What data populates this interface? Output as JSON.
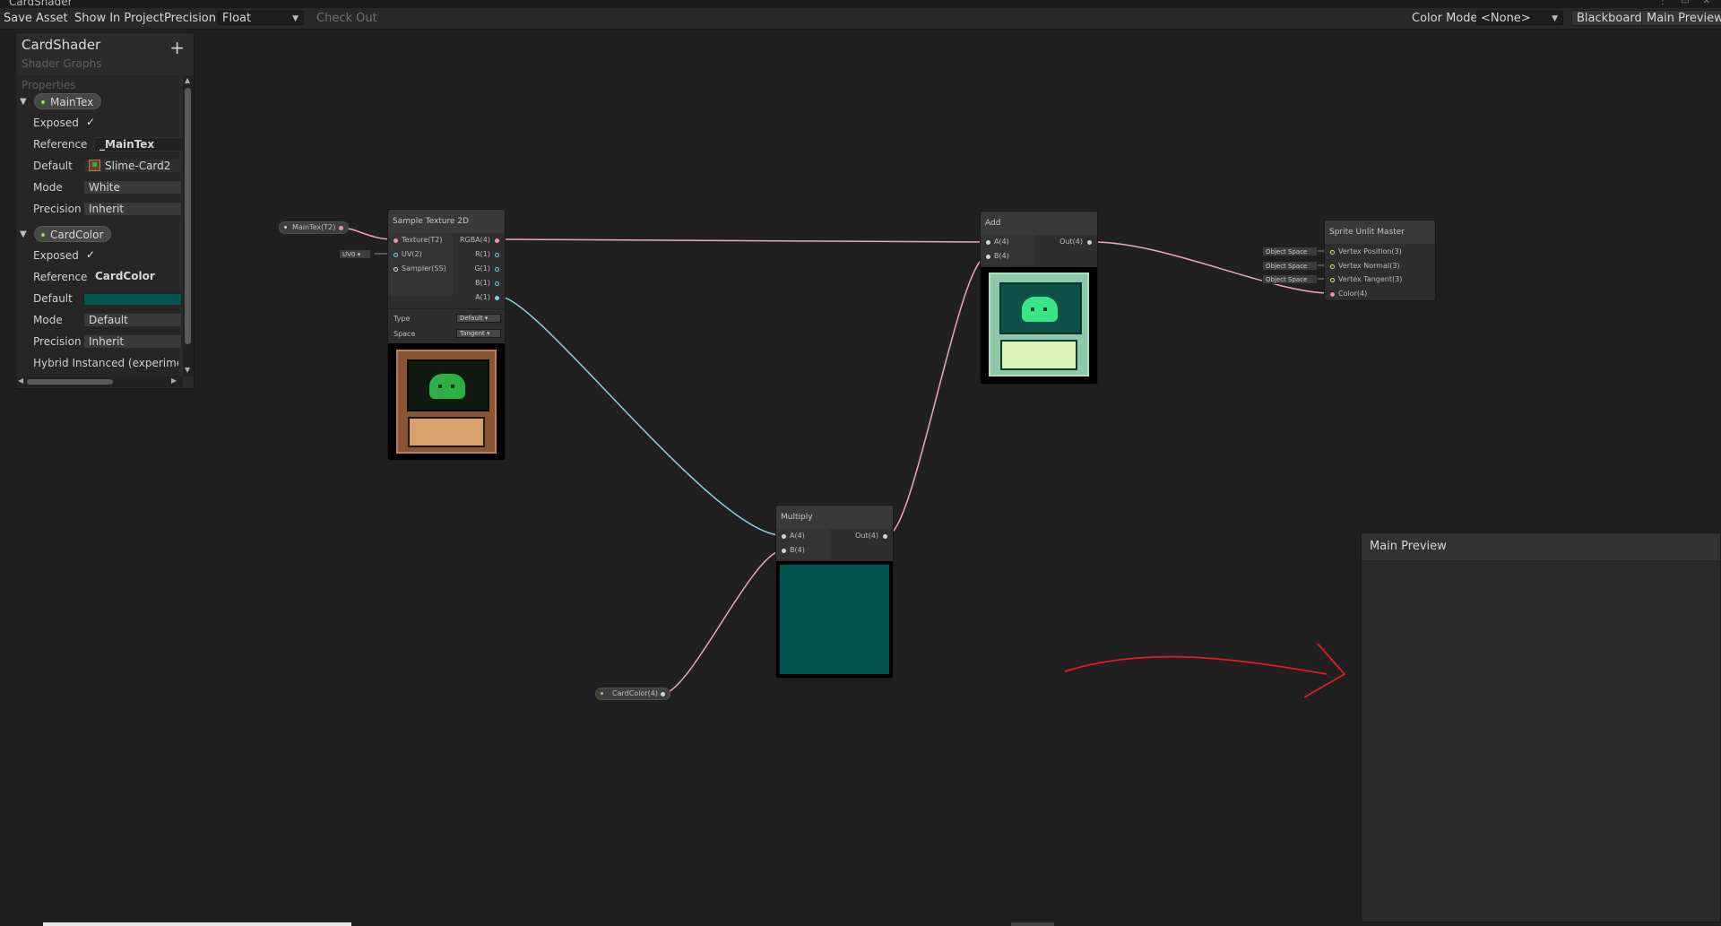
{
  "window": {
    "title": "CardShader"
  },
  "toolbar": {
    "save_asset": "Save Asset",
    "show_in_project": "Show In Project",
    "precision_label": "Precision",
    "precision_value": "Float",
    "check_out": "Check Out",
    "color_mode_label": "Color Mode",
    "color_mode_value": "<None>",
    "blackboard": "Blackboard",
    "main_preview": "Main Preview"
  },
  "blackboard": {
    "title": "CardShader",
    "subtitle": "Shader Graphs",
    "add": "+",
    "section": "Properties",
    "properties": [
      {
        "name": "MainTex",
        "exposed_label": "Exposed",
        "exposed": "✓",
        "reference_label": "Reference",
        "reference": "_MainTex",
        "default_label": "Default",
        "default": "Slime-Card2",
        "mode_label": "Mode",
        "mode": "White",
        "precision_label": "Precision",
        "precision": "Inherit"
      },
      {
        "name": "CardColor",
        "exposed_label": "Exposed",
        "exposed": "✓",
        "reference_label": "Reference",
        "reference": "CardColor",
        "default_label": "Default",
        "default_color": "#03564f",
        "mode_label": "Mode",
        "mode": "Default",
        "precision_label": "Precision",
        "precision": "Inherit",
        "hybrid": "Hybrid Instanced (experimental)"
      }
    ]
  },
  "graph": {
    "maintex_node": "MainTex(T2)",
    "uv_tag": "UV0",
    "sample": {
      "title": "Sample Texture 2D",
      "inputs": [
        "Texture(T2)",
        "UV(2)",
        "Sampler(SS)"
      ],
      "outputs": [
        "RGBA(4)",
        "R(1)",
        "G(1)",
        "B(1)",
        "A(1)"
      ],
      "type_label": "Type",
      "type_value": "Default",
      "space_label": "Space",
      "space_value": "Tangent"
    },
    "add": {
      "title": "Add",
      "inputs": [
        "A(4)",
        "B(4)"
      ],
      "output": "Out(4)"
    },
    "multiply": {
      "title": "Multiply",
      "inputs": [
        "A(4)",
        "B(4)"
      ],
      "output": "Out(4)"
    },
    "cardcolor_node": "CardColor(4)",
    "master": {
      "title": "Sprite Unlit Master",
      "tags": [
        "Object Space",
        "Object Space",
        "Object Space"
      ],
      "inputs": [
        "Vertex Position(3)",
        "Vertex Normal(3)",
        "Vertex Tangent(3)",
        "Color(4)"
      ]
    }
  },
  "main_preview": {
    "title": "Main Preview"
  },
  "colors": {
    "background": "#202020",
    "card_color": "#03564f",
    "edge_pink": "#e8a7c8",
    "edge_cyan": "#8cd2e0",
    "annotation": "#e21b1b"
  }
}
